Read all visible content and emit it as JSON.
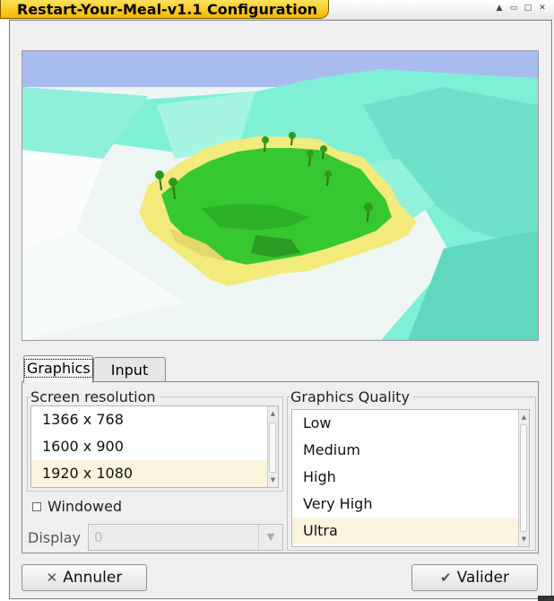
{
  "window": {
    "title": "Restart-Your-Meal-v1.1 Configuration",
    "controls": [
      "▲",
      "▭",
      "□",
      "✕"
    ]
  },
  "tabs": [
    {
      "label": "Graphics",
      "active": true
    },
    {
      "label": "Input",
      "active": false
    }
  ],
  "resolution": {
    "label": "Screen resolution",
    "items": [
      "1366 x 768",
      "1600 x 900",
      "1920 x 1080"
    ],
    "selected": "1920 x 1080"
  },
  "quality": {
    "label": "Graphics Quality",
    "items": [
      "Low",
      "Medium",
      "High",
      "Very High",
      "Ultra"
    ],
    "selected": "Ultra"
  },
  "windowed": {
    "label": "Windowed",
    "checked": false
  },
  "display": {
    "label": "Display",
    "value": "0"
  },
  "buttons": {
    "cancel": "Annuler",
    "ok": "Valider"
  },
  "colors": {
    "title_accent": "#f2b800",
    "selected_row": "#fbf4dc"
  }
}
